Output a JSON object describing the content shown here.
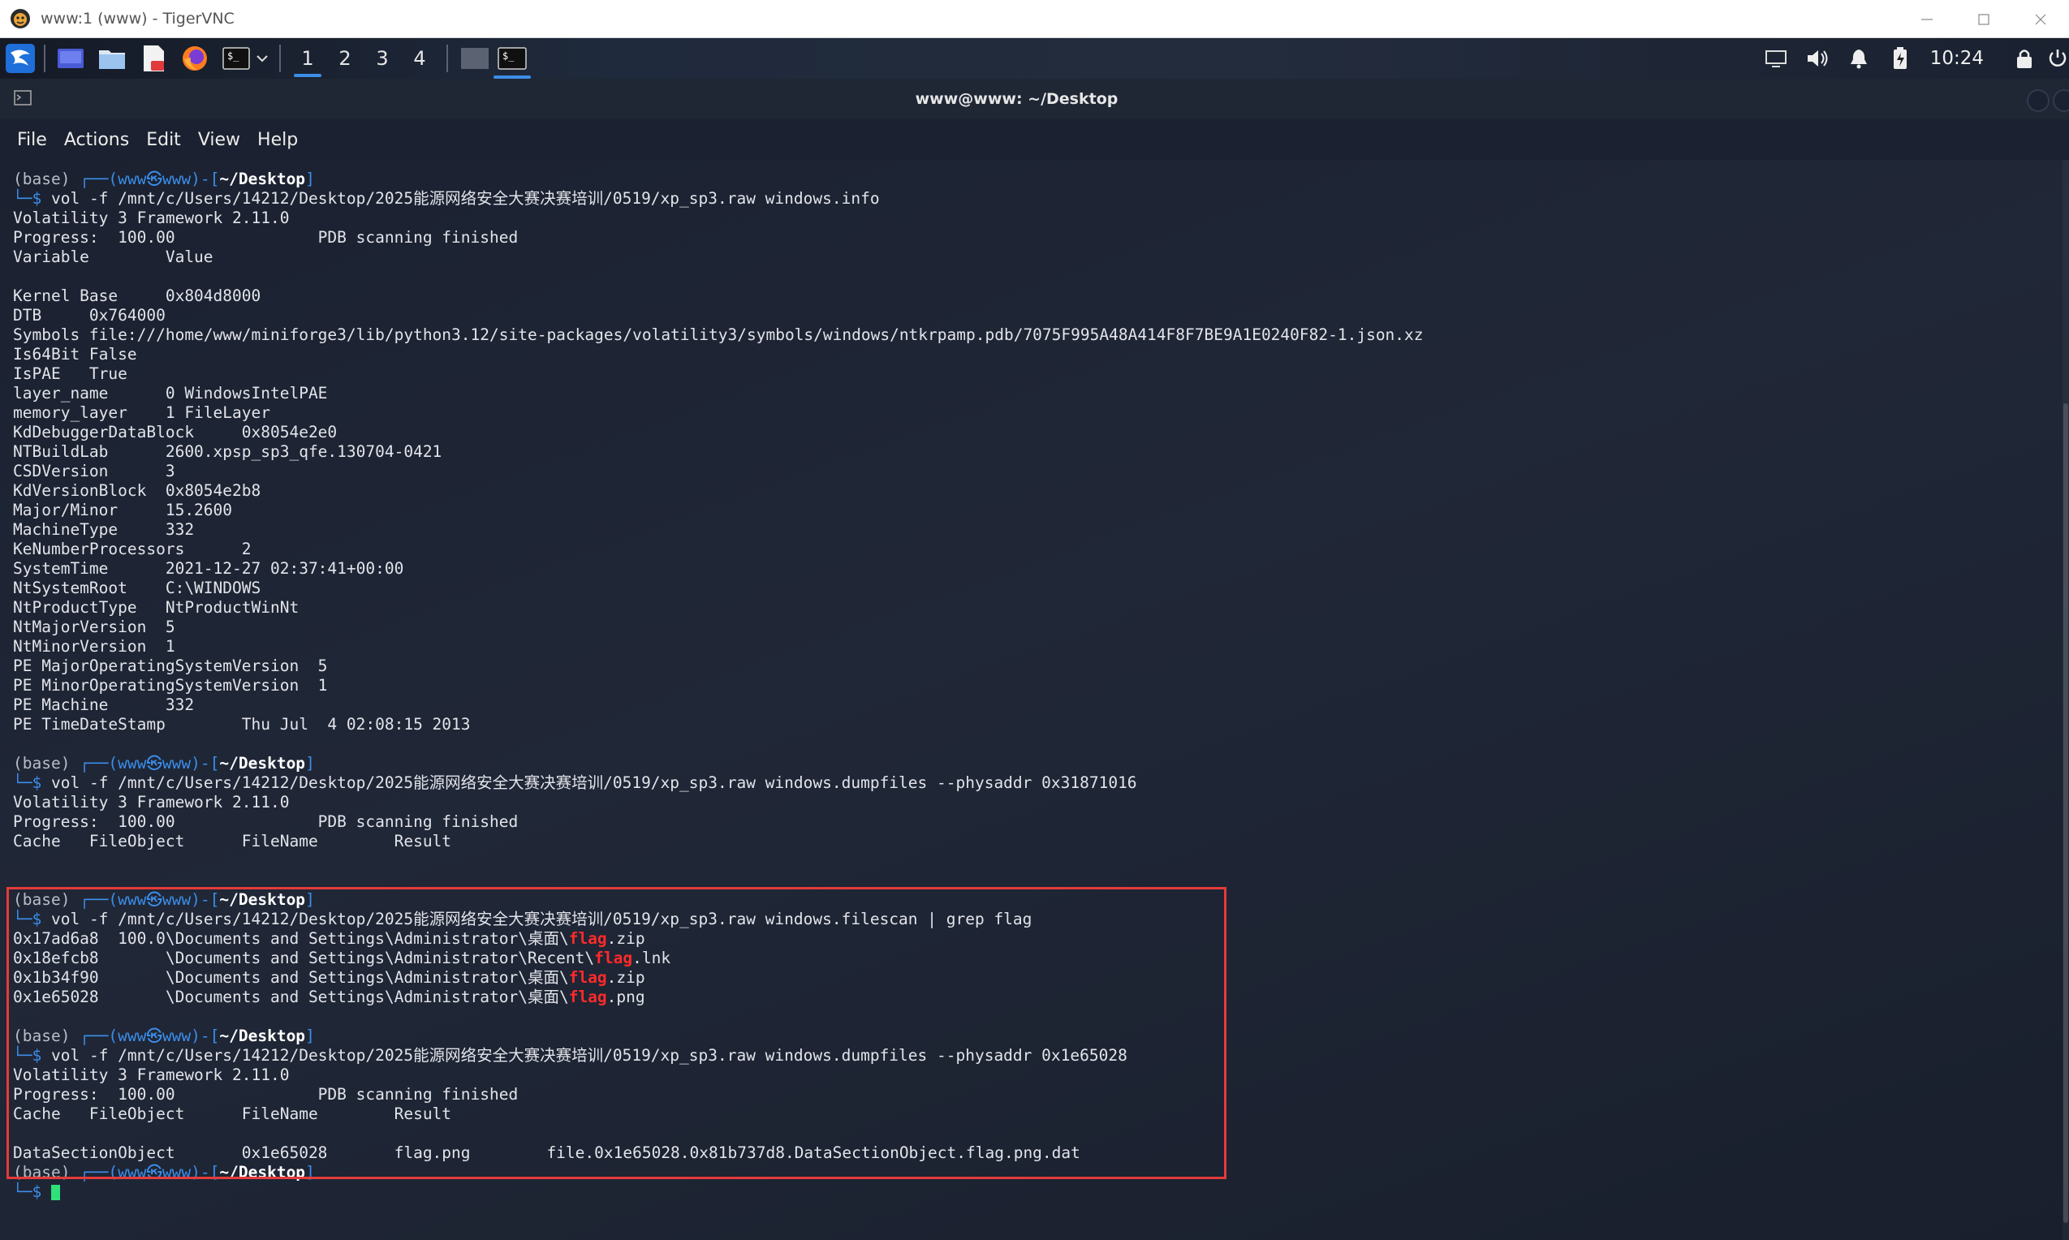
{
  "vnc": {
    "title": "www:1 (www) - TigerVNC"
  },
  "panel": {
    "workspaces": [
      "1",
      "2",
      "3",
      "4"
    ],
    "active_workspace": "1",
    "clock": "10:24",
    "launchers": [
      "kali-menu-icon",
      "desktop-icon",
      "files-icon",
      "text-editor-icon",
      "firefox-icon",
      "terminal-icon"
    ],
    "tray": [
      "display-icon",
      "volume-icon",
      "bell-icon",
      "battery-icon",
      "lock-icon",
      "power-icon"
    ],
    "accent_color": "#3d8ee8"
  },
  "terminal": {
    "title": "www@www: ~/Desktop",
    "menu": [
      "File",
      "Actions",
      "Edit",
      "View",
      "Help"
    ],
    "highlight_color": "#e53b3b",
    "prompt": {
      "env": "(base)",
      "open": "┌──(",
      "user": "www",
      "at": "㉿",
      "host": "www",
      "mid": ")-[",
      "path": "~/Desktop",
      "close": "]",
      "arrow": "└─",
      "dollar": "$"
    },
    "commands": {
      "c1": "vol -f /mnt/c/Users/14212/Desktop/2025能源网络安全大赛决赛培训/0519/xp_sp3.raw windows.info",
      "c2": "vol -f /mnt/c/Users/14212/Desktop/2025能源网络安全大赛决赛培训/0519/xp_sp3.raw windows.dumpfiles --physaddr 0x31871016",
      "c3": "vol -f /mnt/c/Users/14212/Desktop/2025能源网络安全大赛决赛培训/0519/xp_sp3.raw windows.filescan | grep flag",
      "c4": "vol -f /mnt/c/Users/14212/Desktop/2025能源网络安全大赛决赛培训/0519/xp_sp3.raw windows.dumpfiles --physaddr 0x1e65028"
    },
    "output1": [
      "Volatility 3 Framework 2.11.0",
      "Progress:  100.00               PDB scanning finished",
      "Variable        Value",
      "",
      "Kernel Base     0x804d8000",
      "DTB     0x764000",
      "Symbols file:///home/www/miniforge3/lib/python3.12/site-packages/volatility3/symbols/windows/ntkrpamp.pdb/7075F995A48A414F8F7BE9A1E0240F82-1.json.xz",
      "Is64Bit False",
      "IsPAE   True",
      "layer_name      0 WindowsIntelPAE",
      "memory_layer    1 FileLayer",
      "KdDebuggerDataBlock     0x8054e2e0",
      "NTBuildLab      2600.xpsp_sp3_qfe.130704-0421",
      "CSDVersion      3",
      "KdVersionBlock  0x8054e2b8",
      "Major/Minor     15.2600",
      "MachineType     332",
      "KeNumberProcessors      2",
      "SystemTime      2021-12-27 02:37:41+00:00",
      "NtSystemRoot    C:\\WINDOWS",
      "NtProductType   NtProductWinNt",
      "NtMajorVersion  5",
      "NtMinorVersion  1",
      "PE MajorOperatingSystemVersion  5",
      "PE MinorOperatingSystemVersion  1",
      "PE Machine      332",
      "PE TimeDateStamp        Thu Jul  4 02:08:15 2013"
    ],
    "output2": [
      "Volatility 3 Framework 2.11.0",
      "Progress:  100.00               PDB scanning finished",
      "Cache   FileObject      FileName        Result"
    ],
    "filescan": [
      {
        "pre": "0x17ad6a8  100.0\\Documents and Settings\\Administrator\\桌面\\",
        "hit": "flag",
        "post": ".zip"
      },
      {
        "pre": "0x18efcb8       \\Documents and Settings\\Administrator\\Recent\\",
        "hit": "flag",
        "post": ".lnk"
      },
      {
        "pre": "0x1b34f90       \\Documents and Settings\\Administrator\\桌面\\",
        "hit": "flag",
        "post": ".zip"
      },
      {
        "pre": "0x1e65028       \\Documents and Settings\\Administrator\\桌面\\",
        "hit": "flag",
        "post": ".png"
      }
    ],
    "output4": [
      "Volatility 3 Framework 2.11.0",
      "Progress:  100.00               PDB scanning finished",
      "Cache   FileObject      FileName        Result",
      "",
      "DataSectionObject       0x1e65028       flag.png        file.0x1e65028.0x81b737d8.DataSectionObject.flag.png.dat"
    ]
  }
}
